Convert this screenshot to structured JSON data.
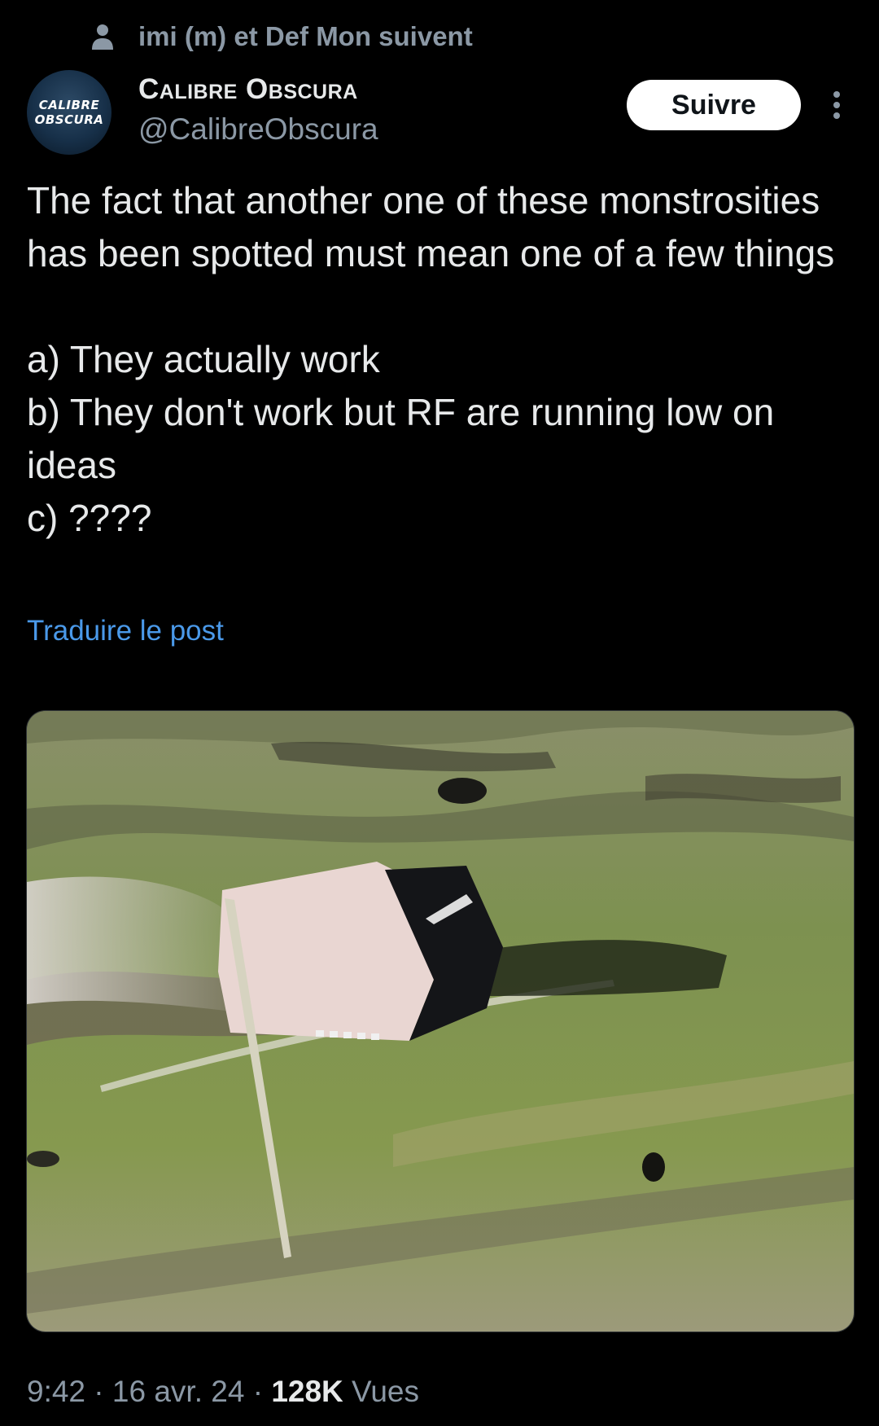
{
  "social_context": {
    "icon": "person-icon",
    "text": "imi (m) et Def Mon suivent"
  },
  "author": {
    "avatar_text_line1": "CALIBRE",
    "avatar_text_line2": "OBSCURA",
    "display_name": "Calibre Obscura",
    "handle": "@CalibreObscura"
  },
  "actions": {
    "follow_label": "Suivre",
    "more_icon": "more-vertical-icon"
  },
  "post": {
    "paragraph_1": "The fact that another one of these monstrosities has been spotted must mean one of a few things",
    "line_a": "a) They actually work",
    "line_b": "b) They don't work but RF are running low on ideas",
    "line_c": "c) ????",
    "translate_label": "Traduire le post"
  },
  "meta": {
    "time": "9:42",
    "separator": "·",
    "date": "16 avr. 24",
    "views_count": "128K",
    "views_label": "Vues"
  },
  "colors": {
    "background": "#000000",
    "text_primary": "#e7e9ea",
    "text_secondary": "#8b98a5",
    "link": "#4a99e9",
    "button_bg": "#ffffff"
  }
}
